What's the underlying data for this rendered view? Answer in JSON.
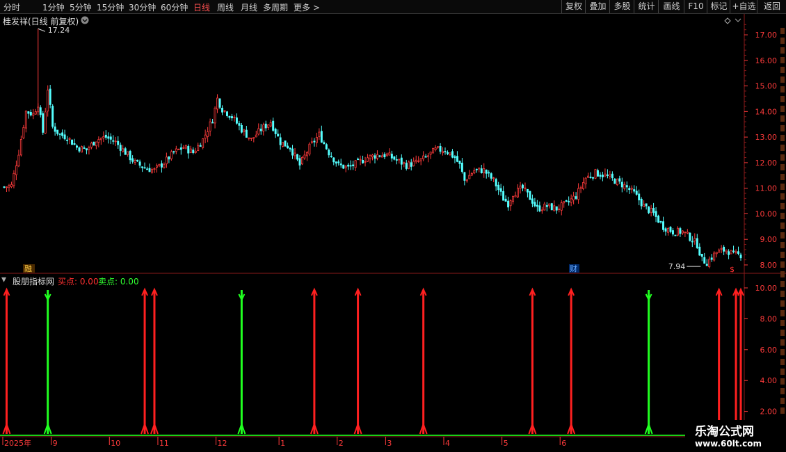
{
  "toolbar": {
    "periods": [
      "分时",
      "1分钟",
      "5分钟",
      "15分钟",
      "30分钟",
      "60分钟",
      "日线",
      "周线",
      "月线",
      "多周期",
      "更多"
    ],
    "active_period": "日线",
    "right_buttons": [
      "复权",
      "叠加",
      "多股",
      "统计",
      "画线",
      "F10",
      "标记",
      "+自选",
      "返回"
    ]
  },
  "main_chart": {
    "title": "桂发祥(日线 前复权)",
    "high_label": "17.24",
    "low_label": "7.94",
    "y_ticks": [
      "17.00",
      "16.00",
      "15.00",
      "14.00",
      "13.00",
      "12.00",
      "11.00",
      "10.00",
      "9.00",
      "8.00"
    ],
    "badges": {
      "left": "融",
      "mid": "财",
      "right": "$"
    }
  },
  "indicator": {
    "name": "股朋指标网",
    "buy_label": "买点: 0.00",
    "sell_label": "卖点: 0.00",
    "y_ticks": [
      "10.00",
      "8.00",
      "6.00",
      "4.00",
      "2.00"
    ]
  },
  "dates": [
    "2025年",
    "9",
    "10",
    "11",
    "12",
    "1",
    "2",
    "3",
    "4",
    "5",
    "6"
  ],
  "logo": {
    "main": "乐淘公式网",
    "url": "www.60lt.com"
  },
  "colors": {
    "up": "#ff3b3b",
    "down": "#54ffff",
    "buy": "#ff2020",
    "sell": "#20ff20",
    "axis": "#ff3b3b"
  },
  "chart_data": {
    "type": "candlestick",
    "price_anchors": [
      [
        0,
        11.05
      ],
      [
        3,
        11.1
      ],
      [
        6,
        12.4
      ],
      [
        9,
        14.0
      ],
      [
        12,
        13.9
      ],
      [
        14,
        14.3
      ],
      [
        16,
        13.2
      ],
      [
        18,
        14.9
      ],
      [
        20,
        13.4
      ],
      [
        23,
        13.1
      ],
      [
        26,
        13.0
      ],
      [
        30,
        12.6
      ],
      [
        34,
        12.5
      ],
      [
        38,
        12.9
      ],
      [
        42,
        13.0
      ],
      [
        46,
        12.8
      ],
      [
        50,
        12.4
      ],
      [
        54,
        12.0
      ],
      [
        58,
        11.8
      ],
      [
        62,
        11.7
      ],
      [
        66,
        12.0
      ],
      [
        70,
        12.4
      ],
      [
        74,
        12.6
      ],
      [
        78,
        12.4
      ],
      [
        82,
        12.9
      ],
      [
        86,
        13.7
      ],
      [
        88,
        14.5
      ],
      [
        90,
        14.1
      ],
      [
        94,
        13.8
      ],
      [
        98,
        13.3
      ],
      [
        102,
        12.9
      ],
      [
        106,
        13.3
      ],
      [
        110,
        13.6
      ],
      [
        114,
        12.8
      ],
      [
        118,
        12.6
      ],
      [
        122,
        11.9
      ],
      [
        126,
        12.6
      ],
      [
        130,
        13.1
      ],
      [
        134,
        12.4
      ],
      [
        138,
        11.9
      ],
      [
        142,
        11.8
      ],
      [
        146,
        12.0
      ],
      [
        150,
        12.2
      ],
      [
        154,
        12.3
      ],
      [
        158,
        12.3
      ],
      [
        162,
        12.1
      ],
      [
        166,
        11.9
      ],
      [
        170,
        12.0
      ],
      [
        174,
        12.2
      ],
      [
        178,
        12.5
      ],
      [
        182,
        12.5
      ],
      [
        186,
        12.2
      ],
      [
        188,
        11.9
      ],
      [
        190,
        11.3
      ],
      [
        192,
        11.5
      ],
      [
        194,
        11.7
      ],
      [
        198,
        11.7
      ],
      [
        202,
        11.3
      ],
      [
        206,
        10.6
      ],
      [
        208,
        10.4
      ],
      [
        210,
        10.8
      ],
      [
        214,
        11.0
      ],
      [
        218,
        10.5
      ],
      [
        220,
        10.2
      ],
      [
        224,
        10.3
      ],
      [
        228,
        10.2
      ],
      [
        232,
        10.4
      ],
      [
        236,
        10.7
      ],
      [
        240,
        11.4
      ],
      [
        244,
        11.6
      ],
      [
        248,
        11.5
      ],
      [
        252,
        11.3
      ],
      [
        256,
        11.1
      ],
      [
        260,
        10.8
      ],
      [
        264,
        10.3
      ],
      [
        268,
        10.0
      ],
      [
        272,
        9.5
      ],
      [
        276,
        9.3
      ],
      [
        280,
        9.3
      ],
      [
        284,
        9.0
      ],
      [
        286,
        8.8
      ],
      [
        288,
        8.2
      ],
      [
        290,
        8.1
      ],
      [
        294,
        8.5
      ],
      [
        298,
        8.6
      ],
      [
        301,
        8.4
      ],
      [
        303,
        8.4
      ]
    ],
    "buy_signals_days": [
      1,
      58,
      62,
      128,
      146,
      173,
      218,
      234,
      295,
      302,
      304
    ],
    "sell_signals_days": [
      18,
      98,
      266
    ],
    "y_range": [
      7.7,
      17.6
    ],
    "indicator_range": [
      0,
      10.0
    ]
  }
}
